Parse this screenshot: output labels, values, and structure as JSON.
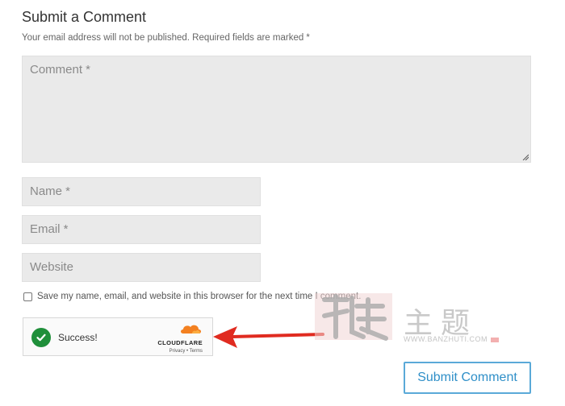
{
  "form": {
    "title": "Submit a Comment",
    "notes": "Your email address will not be published. Required fields are marked *",
    "comment_placeholder": "Comment *",
    "name_placeholder": "Name *",
    "email_placeholder": "Email *",
    "website_placeholder": "Website",
    "save_label": "Save my name, email, and website in this browser for the next time I comment.",
    "save_checked": false,
    "submit_label": "Submit Comment"
  },
  "turnstile": {
    "status": "Success!",
    "brand": "CLOUDFLARE",
    "links": "Privacy • Terms",
    "icon": "check-circle-icon"
  },
  "watermark": {
    "text": "主题",
    "url": "WWW.BANZHUTI.COM"
  },
  "colors": {
    "field_bg": "#eaeaea",
    "submit_accent": "#2f8fc8",
    "success_green": "#1f8f3a",
    "arrow_red": "#e02b20",
    "cloudflare_orange": "#f38020"
  }
}
